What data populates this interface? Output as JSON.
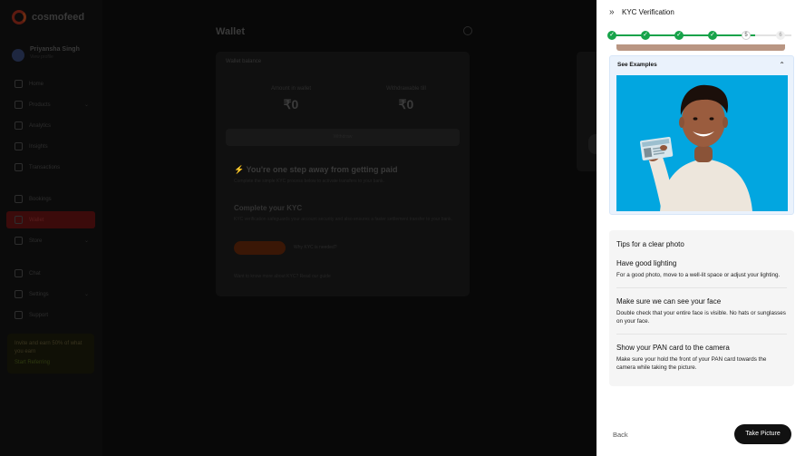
{
  "app": {
    "brand": "cosmofeed"
  },
  "profile": {
    "name": "Priyansha Singh",
    "subtitle": "View profile"
  },
  "sidebar": {
    "items": [
      {
        "label": "Home"
      },
      {
        "label": "Products"
      },
      {
        "label": "Analytics"
      },
      {
        "label": "Insights"
      },
      {
        "label": "Transactions"
      },
      {
        "label": "Bookings"
      },
      {
        "label": "Wallet"
      },
      {
        "label": "Store"
      },
      {
        "label": "Chat"
      },
      {
        "label": "Settings"
      },
      {
        "label": "Support"
      }
    ],
    "promo": {
      "text": "Invite and earn 50% of what you earn",
      "link": "Start Referring"
    }
  },
  "main": {
    "title": "Wallet",
    "balance_header": "Wallet balance",
    "amount_in_wallet_label": "Amount in wallet",
    "amount_in_wallet": "₹0",
    "withdrawn_label": "Withdrawable till",
    "withdrawn_amount": "₹0",
    "withdraw_bar": "Withdraw",
    "step_heading": "⚡ You're one step away from getting paid",
    "step_sub": "Complete the simple KYC process below to activate transfers to your bank.",
    "kyc_title": "Complete your KYC",
    "kyc_desc": "KYC verification safeguards your account security and also ensures a faster settlement transfer to your bank.",
    "kyc_button": "Complete KYC",
    "kyc_link": "Why KYC is needed?",
    "footer": "Want to know more about KYC? Read our guide"
  },
  "panel": {
    "collapse_icon": "double-chevron-right-icon",
    "title": "KYC Verification",
    "stepper": {
      "steps": [
        {
          "state": "done",
          "glyph": "✓"
        },
        {
          "state": "done",
          "glyph": "✓"
        },
        {
          "state": "done",
          "glyph": "✓"
        },
        {
          "state": "done",
          "glyph": "✓"
        },
        {
          "state": "current",
          "glyph": "5"
        },
        {
          "state": "pending",
          "glyph": "6"
        }
      ],
      "accent": "#17a34a"
    },
    "examples": {
      "title": "See Examples",
      "chevron": "⌃"
    },
    "tips": {
      "title": "Tips for a clear photo",
      "items": [
        {
          "heading": "Have good lighting",
          "body": "For a good photo, move to a well-lit space or adjust your lighting."
        },
        {
          "heading": "Make sure we can see your face",
          "body": "Double check that your entire face is visible. No hats or sunglasses on your face."
        },
        {
          "heading": "Show your PAN card to the camera",
          "body": "Make sure your hold the front of your PAN card towards the camera while taking the picture."
        }
      ]
    },
    "back_label": "Back",
    "take_picture_label": "Take Picture"
  },
  "colors": {
    "primary_dark": "#111111",
    "example_bg": "#02a6e0",
    "success": "#17a34a"
  }
}
